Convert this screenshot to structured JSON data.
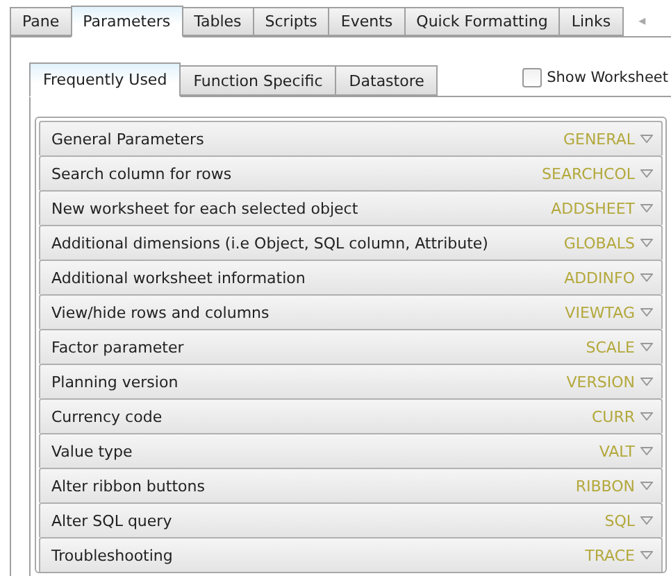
{
  "tabs": [
    {
      "label": "Pane",
      "selected": false
    },
    {
      "label": "Parameters",
      "selected": true
    },
    {
      "label": "Tables",
      "selected": false
    },
    {
      "label": "Scripts",
      "selected": false
    },
    {
      "label": "Events",
      "selected": false
    },
    {
      "label": "Quick Formatting",
      "selected": false
    },
    {
      "label": "Links",
      "selected": false
    }
  ],
  "tab_scroll": "◂",
  "subtabs": [
    {
      "label": "Frequently Used",
      "selected": true
    },
    {
      "label": "Function Specific",
      "selected": false
    },
    {
      "label": "Datastore",
      "selected": false
    }
  ],
  "show_worksheet": {
    "label": "Show Worksheet",
    "checked": false
  },
  "sections": [
    {
      "title": "General Parameters",
      "code": "GENERAL"
    },
    {
      "title": "Search column for rows",
      "code": "SEARCHCOL"
    },
    {
      "title": "New worksheet for each selected object",
      "code": "ADDSHEET"
    },
    {
      "title": "Additional dimensions (i.e Object, SQL column, Attribute)",
      "code": "GLOBALS"
    },
    {
      "title": "Additional worksheet information",
      "code": "ADDINFO"
    },
    {
      "title": "View/hide rows and columns",
      "code": "VIEWTAG"
    },
    {
      "title": "Factor parameter",
      "code": "SCALE"
    },
    {
      "title": "Planning version",
      "code": "VERSION"
    },
    {
      "title": "Currency code",
      "code": "CURR"
    },
    {
      "title": "Value type",
      "code": "VALT"
    },
    {
      "title": "Alter ribbon buttons",
      "code": "RIBBON"
    },
    {
      "title": "Alter SQL query",
      "code": "SQL"
    },
    {
      "title": "Troubleshooting",
      "code": "TRACE"
    }
  ]
}
